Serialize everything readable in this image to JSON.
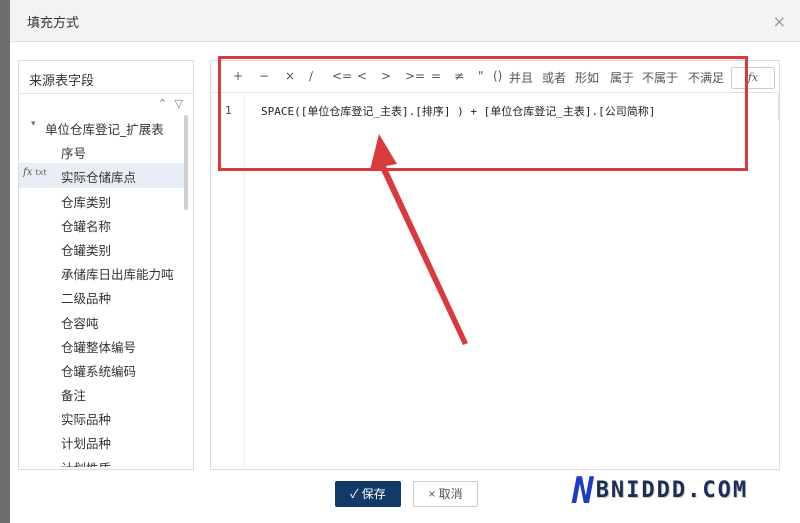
{
  "dialog": {
    "title": "填充方式",
    "close_glyph": "×"
  },
  "source_panel": {
    "title": "来源表字段",
    "tool_icons": [
      "double-chevron-up-icon",
      "filter-icon"
    ],
    "tree": [
      {
        "label": "单位仓库登记_扩展表",
        "parent": true
      },
      {
        "label": "序号"
      },
      {
        "label": "实际仓储库点",
        "selected": true,
        "fx": "fx",
        "fx_sub": "txt"
      },
      {
        "label": "仓库类别"
      },
      {
        "label": "仓罐名称"
      },
      {
        "label": "仓罐类别"
      },
      {
        "label": "承储库日出库能力吨"
      },
      {
        "label": "二级品种"
      },
      {
        "label": "仓容吨"
      },
      {
        "label": "仓罐整体编号"
      },
      {
        "label": "仓罐系统编码"
      },
      {
        "label": "备注"
      },
      {
        "label": "实际品种"
      },
      {
        "label": "计划品种"
      },
      {
        "label": "计划性质"
      }
    ]
  },
  "toolbar": {
    "ops": [
      "+",
      "−",
      "×",
      "∕",
      "<=",
      "<",
      ">",
      ">=",
      "=",
      "≠",
      "\"",
      "()",
      "并且",
      "或者",
      "形如",
      "属于",
      "不属于",
      "不满足"
    ],
    "fx_label": "fx"
  },
  "editor": {
    "line_number": "1",
    "code": "SPACE([单位仓库登记_主表].[排序] )  + [单位仓库登记_主表].[公司简称]"
  },
  "footer": {
    "save_label": "✓ 保存",
    "cancel_label": "× 取消"
  },
  "watermark": {
    "n": "N",
    "rest": "BNIDDD.COM"
  },
  "colors": {
    "highlight": "#d93a3e",
    "primary": "#123a69"
  }
}
